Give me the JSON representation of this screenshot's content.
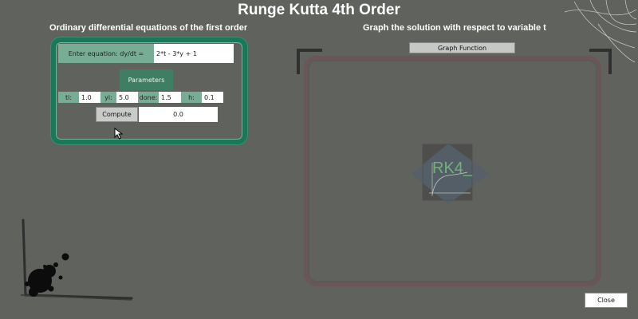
{
  "window": {
    "title": "Runge Kutta 4th Order"
  },
  "left_panel": {
    "heading": "Ordinary differential equations of the first order",
    "equation_label": "Enter equation: dy/dt =",
    "equation_value": "2*t - 3*y + 1",
    "parameters_label": "Parameters",
    "params": [
      {
        "label": "ti:",
        "value": "1.0"
      },
      {
        "label": "yi:",
        "value": "5.0"
      },
      {
        "label": "done:",
        "value": "1.5"
      },
      {
        "label": "h:",
        "value": "0.1"
      }
    ],
    "compute_label": "Compute",
    "result_value": "0.0"
  },
  "right_panel": {
    "heading": "Graph the solution with respect to variable t",
    "graph_button_label": "Graph Function",
    "watermark_text": "RK4_"
  },
  "footer": {
    "close_label": "Close"
  },
  "colors": {
    "background": "#5f625d",
    "accent_green": "#18795a",
    "label_green": "#76ad94",
    "graph_frame": "#6a5558"
  },
  "icons": [
    "mouse-cursor-icon",
    "rk4-logo-icon",
    "ink-splatter-icon",
    "corner-decoration-icon",
    "scribble-decoration-icon"
  ]
}
